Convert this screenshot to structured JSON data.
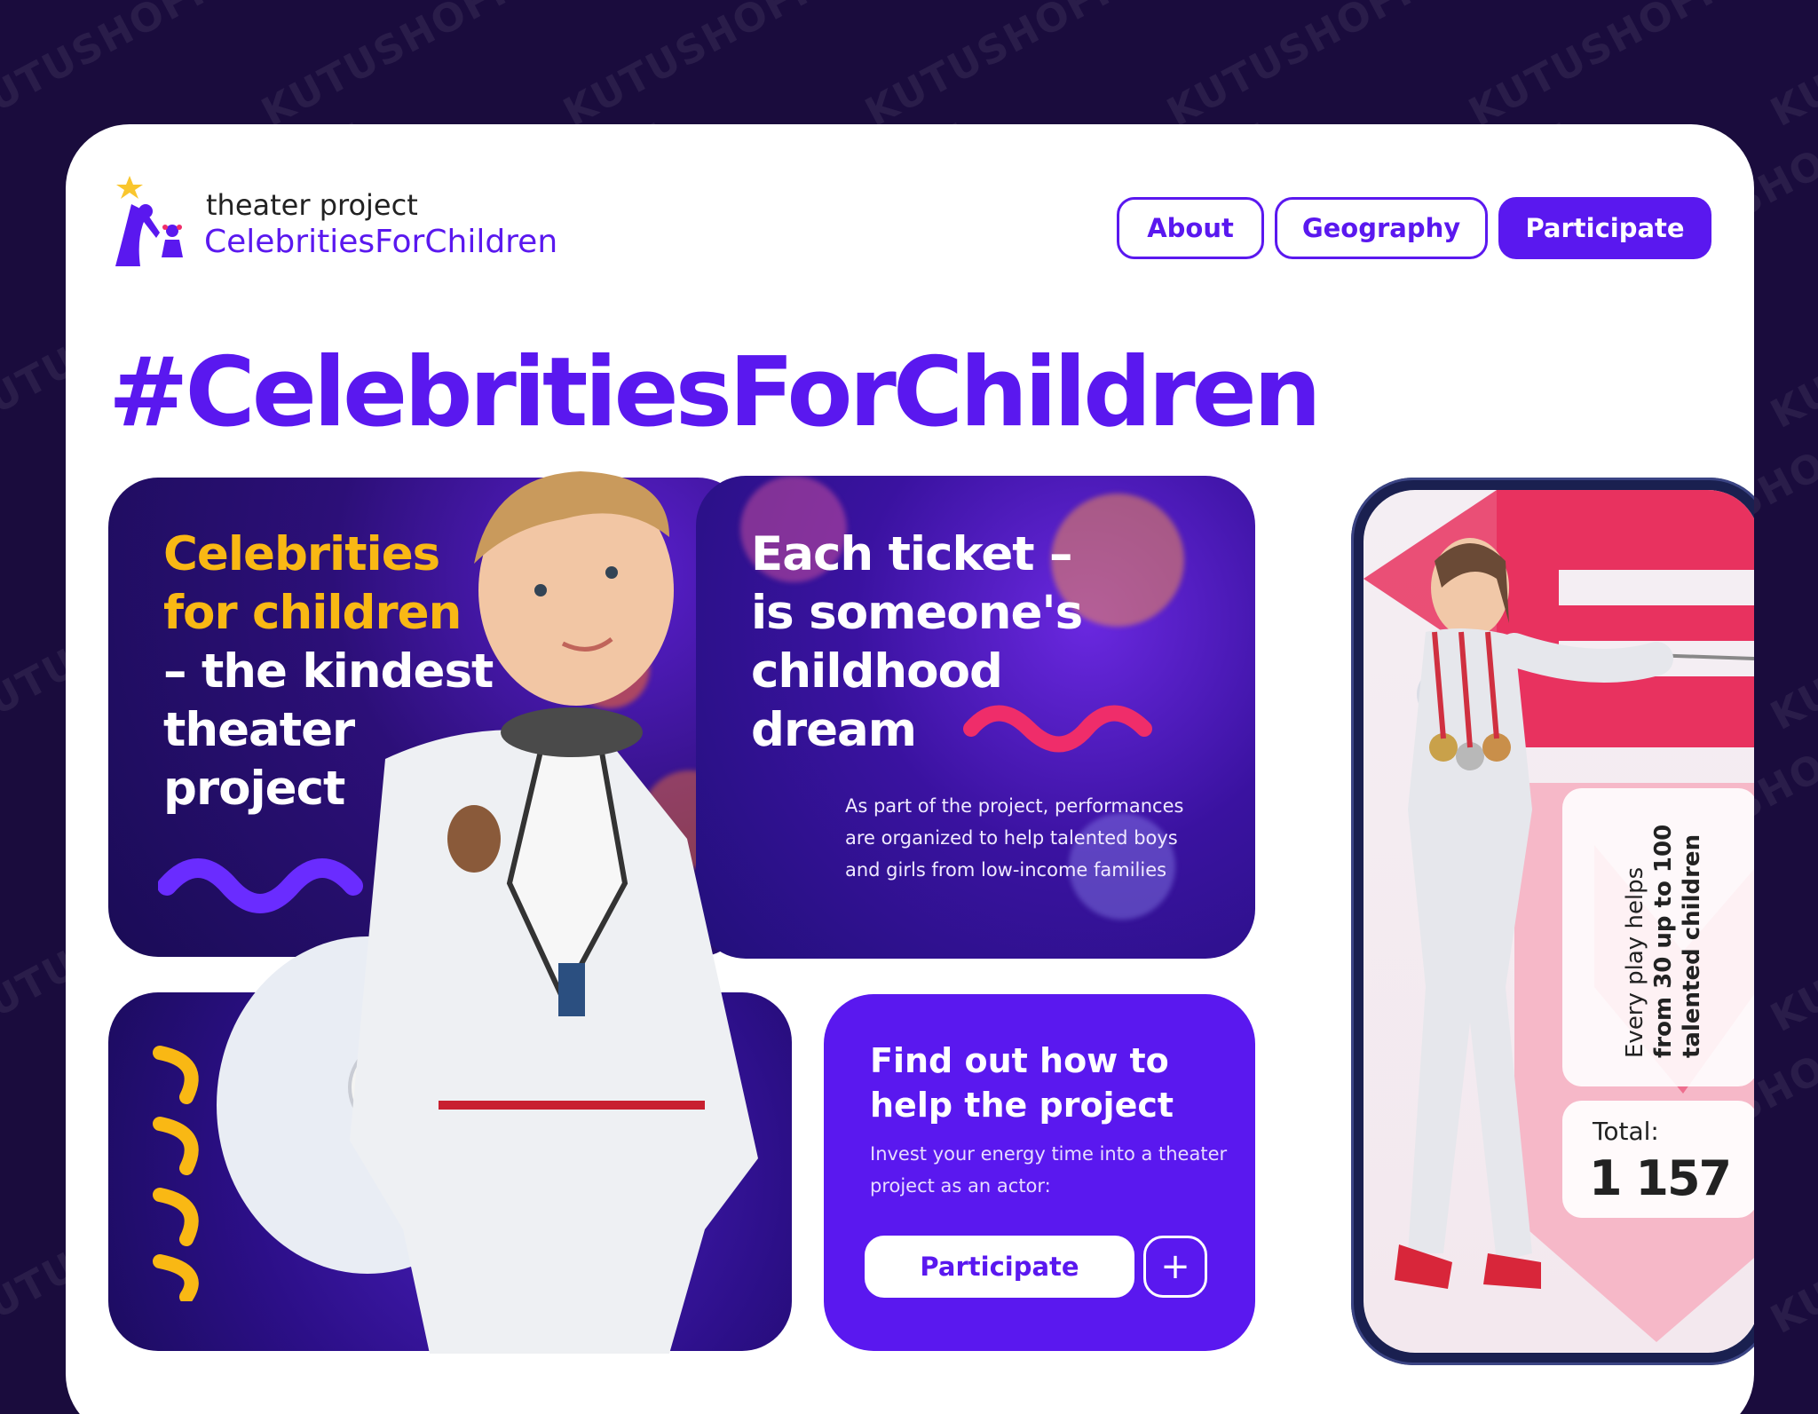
{
  "watermark": "KUTUSHOFF",
  "header": {
    "logo_small": "theater project",
    "logo_big": "CelebritiesForChildren",
    "nav": [
      "About",
      "Geography",
      "Participate"
    ]
  },
  "hero": {
    "hashtag": "#CelebritiesForChildren"
  },
  "panel1": {
    "line_yellow_1": "Celebrities",
    "line_yellow_2": "for children",
    "line_white_1": "– the kindest",
    "line_white_2": "theater",
    "line_white_3": "project"
  },
  "panel2": {
    "line_1": "Each ticket –",
    "line_2": "is someone's",
    "line_3": "childhood",
    "line_4": "dream",
    "description": "As part of the project, performances are organized to help talented boys and girls from low-income families"
  },
  "panel4": {
    "title": "Find out how to help the project",
    "description": "Invest your energy time into a theater project as an actor:",
    "button": "Participate",
    "plus": "+"
  },
  "phone": {
    "line_1": "Every play helps",
    "line_2": "from 30 up to 100",
    "line_3": "talented children",
    "total_label": "Total:",
    "total_value": "1 157"
  },
  "colors": {
    "brand": "#5a18ef",
    "accent_yellow": "#f9b814",
    "accent_pink": "#ef2d6a",
    "background": "#1a0c3d"
  }
}
